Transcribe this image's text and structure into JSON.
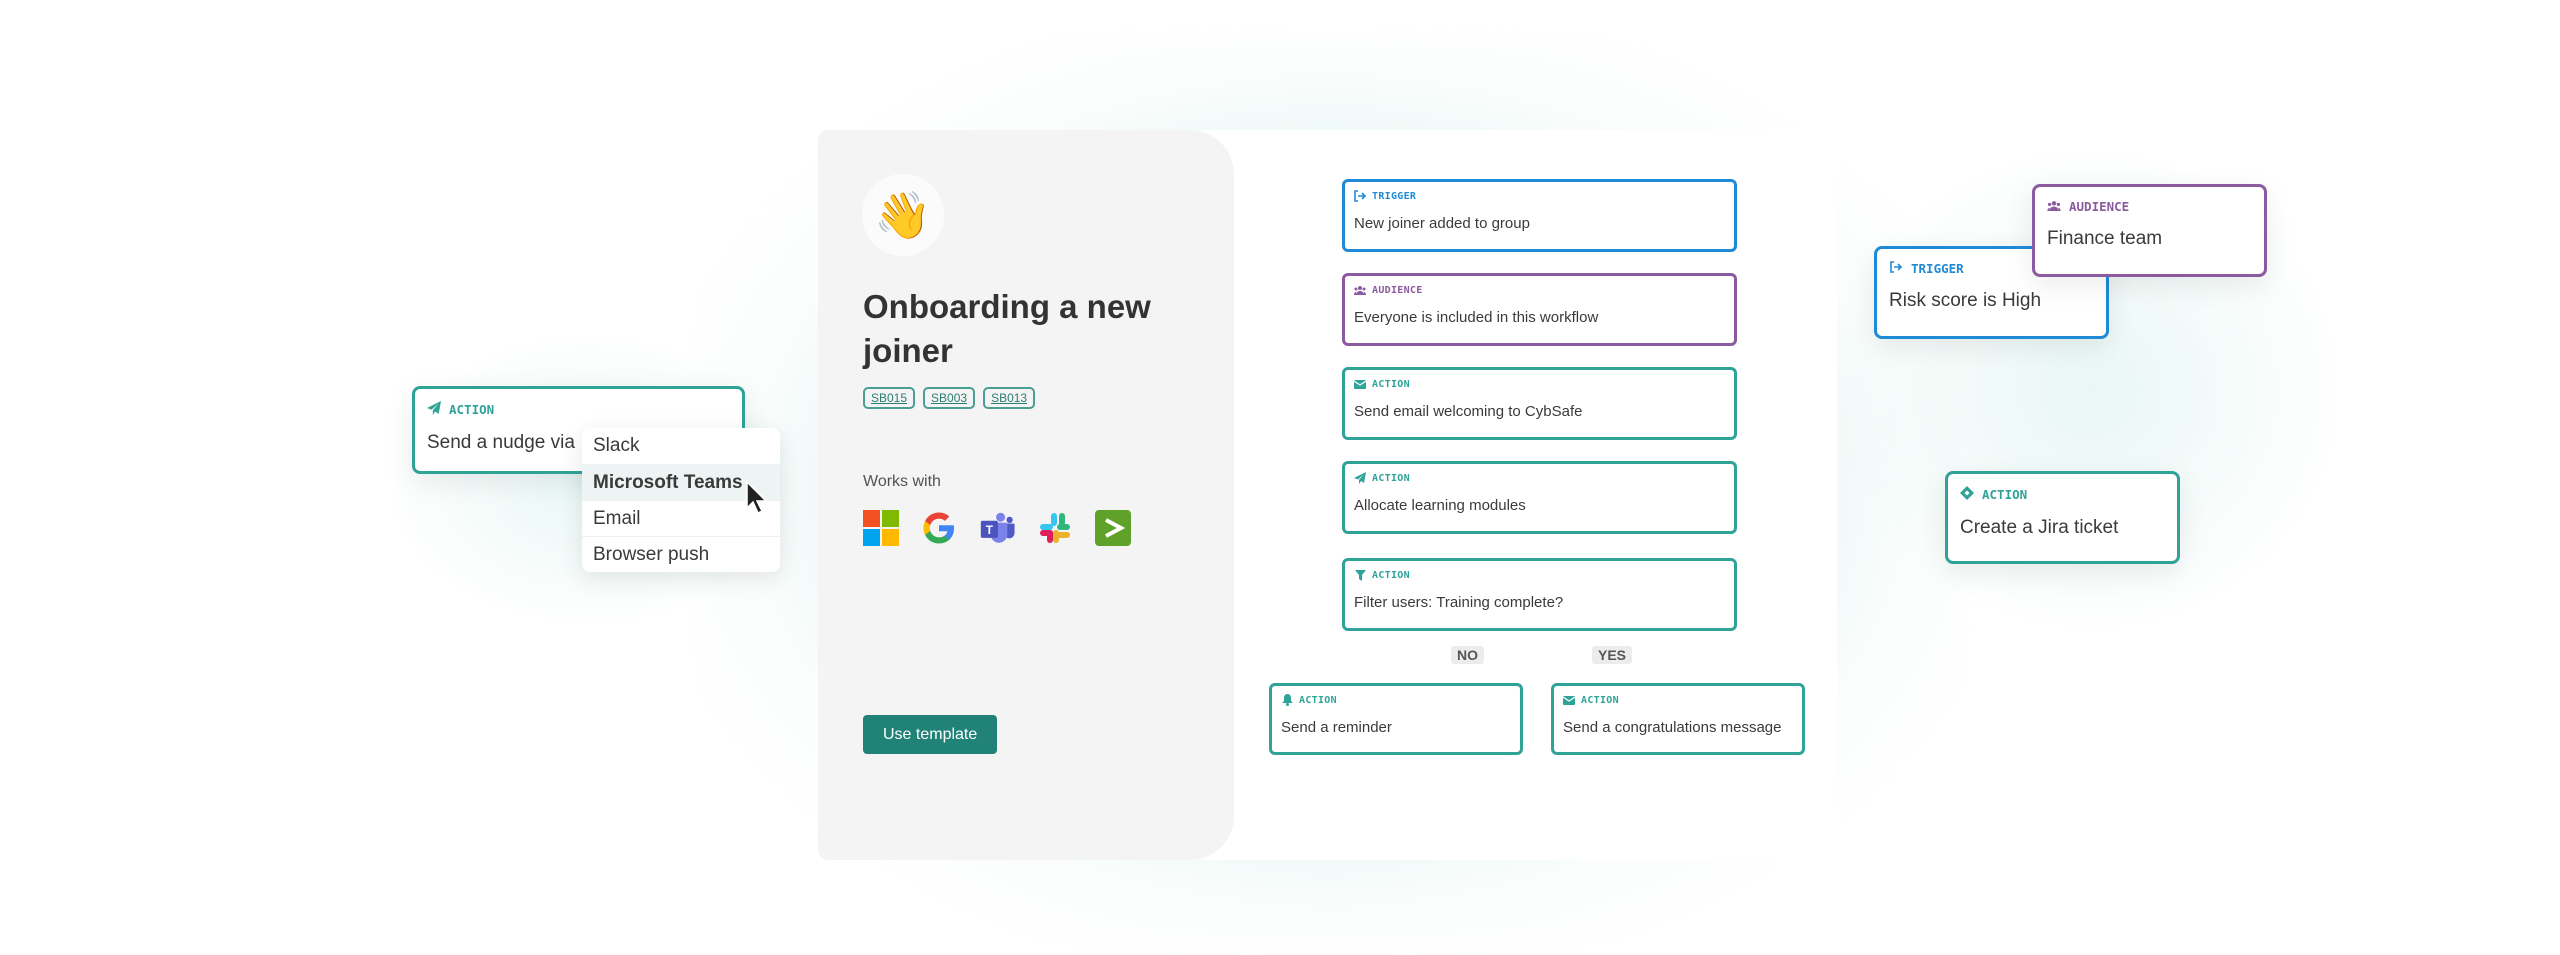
{
  "template": {
    "emoji": "👋",
    "title": "Onboarding a new joiner",
    "tags": [
      "SB015",
      "SB003",
      "SB013"
    ],
    "works_with_label": "Works with",
    "integrations": [
      "microsoft-logo",
      "google-logo",
      "microsoft-teams-logo",
      "slack-logo",
      "terminal-logo"
    ],
    "use_button": "Use template"
  },
  "flow": {
    "nodes": [
      {
        "type": "TRIGGER",
        "icon": "trigger-icon",
        "text": "New joiner added to group"
      },
      {
        "type": "AUDIENCE",
        "icon": "audience-icon",
        "text": "Everyone is included in this workflow"
      },
      {
        "type": "ACTION",
        "icon": "email-icon",
        "text": "Send email welcoming to CybSafe"
      },
      {
        "type": "ACTION",
        "icon": "paper-plane-icon",
        "text": "Allocate learning modules"
      },
      {
        "type": "ACTION",
        "icon": "filter-icon",
        "text": "Filter users: Training complete?"
      }
    ],
    "branches": {
      "no_label": "NO",
      "yes_label": "YES",
      "no_node": {
        "type": "ACTION",
        "icon": "bell-icon",
        "text": "Send a reminder"
      },
      "yes_node": {
        "type": "ACTION",
        "icon": "email-icon",
        "text": "Send a congratulations message"
      }
    }
  },
  "floating": {
    "nudge": {
      "type": "ACTION",
      "icon": "paper-plane-icon",
      "text": "Send a nudge via"
    },
    "dropdown": {
      "options": [
        "Slack",
        "Microsoft Teams",
        "Email",
        "Browser push"
      ],
      "selected": "Microsoft Teams"
    },
    "risk_trigger": {
      "type": "TRIGGER",
      "icon": "trigger-icon",
      "text": "Risk score is High"
    },
    "finance_audience": {
      "type": "AUDIENCE",
      "icon": "audience-icon",
      "text": "Finance team"
    },
    "jira_action": {
      "type": "ACTION",
      "icon": "jira-icon",
      "text": "Create a Jira ticket"
    }
  },
  "colors": {
    "action": "#2fa398",
    "trigger": "#1f8bd6",
    "audience": "#8c5a9e",
    "button": "#218378"
  }
}
